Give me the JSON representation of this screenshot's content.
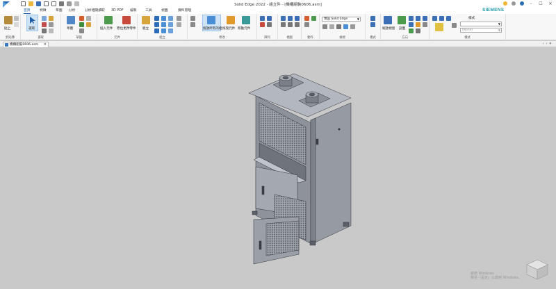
{
  "app": {
    "title": "Solid Edge 2022 - 組立件 - [機櫃組裝0606.asm]",
    "brand": "SIEMENS"
  },
  "tabs": [
    "首頁",
    "特徵",
    "草圖",
    "分析",
    "分析相關讀取",
    "3D PDF",
    "繪製",
    "工具",
    "視圖",
    "資料管理"
  ],
  "active_tab": "首頁",
  "ribbon": {
    "clipboard": {
      "label": "剪貼簿",
      "paste": "貼上"
    },
    "select": {
      "label": "選取",
      "select_btn": "選取"
    },
    "sketch": {
      "label": "草圖",
      "sketch_btn": "草圖"
    },
    "parts": {
      "label": "元件",
      "insert_part": "插入元件",
      "replace_part": "原位更改零件"
    },
    "assemble": {
      "label": "組立",
      "assemble_btn": "組立"
    },
    "modify": {
      "label": "修改",
      "drag_btn": "拖放所有的組",
      "move_btn": "拖曳元件",
      "rotate_btn": "移動元件"
    },
    "pattern": {
      "label": "陣列"
    },
    "views": {
      "label": "視圖"
    },
    "align": {
      "label": "動作"
    },
    "style": {
      "label": "樣式",
      "combo_top": "",
      "combo_bottom": "(None)"
    },
    "orient": {
      "label": "方向",
      "view_btn": "縮放視窗",
      "section_btn": "剖面"
    },
    "display": {
      "label": "檢視",
      "render_combo": "預設 Solid Edge"
    },
    "vis": {
      "label": "模式"
    },
    "style_group": {
      "label": "樣式"
    }
  },
  "document": {
    "tab_name": "機櫃組裝0606.asm"
  },
  "watermark": {
    "line1": "啟用 Windows",
    "line2": "移至「設定」以啟用 Windows。"
  },
  "colors": {
    "accent": "#1f5ea8",
    "siemens": "#1a9aa8",
    "viewport": "#c9c9c9",
    "model": "#8e939c"
  }
}
